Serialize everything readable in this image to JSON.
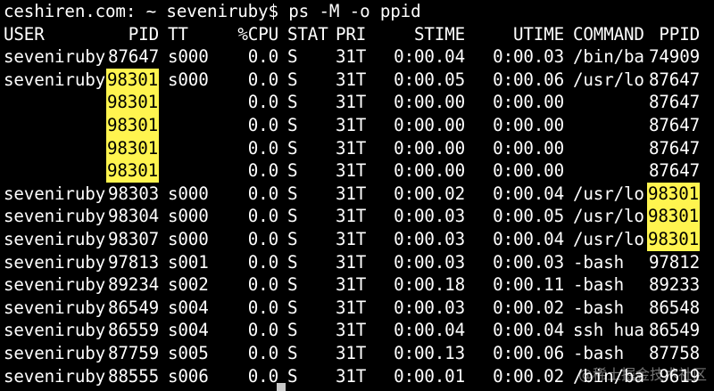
{
  "prompt": "ceshiren.com: ~ seveniruby$ ps -M -o ppid",
  "headers": [
    "USER",
    "PID",
    "TT",
    "%CPU",
    "STAT",
    "PRI",
    "STIME",
    "UTIME",
    "COMMAND",
    "PPID"
  ],
  "rows": [
    {
      "user": "seveniruby",
      "pid": "87647",
      "tt": "s000",
      "cpu": "0.0",
      "stat": "S",
      "pri": "31T",
      "stime": "0:00.04",
      "utime": "0:00.03",
      "command": "/bin/ba",
      "ppid": "74909",
      "pid_hl": false,
      "ppid_hl": false
    },
    {
      "user": "seveniruby",
      "pid": "98301",
      "tt": "s000",
      "cpu": "0.0",
      "stat": "S",
      "pri": "31T",
      "stime": "0:00.05",
      "utime": "0:00.06",
      "command": "/usr/lo",
      "ppid": "87647",
      "pid_hl": true,
      "ppid_hl": false
    },
    {
      "user": "",
      "pid": "98301",
      "tt": "",
      "cpu": "0.0",
      "stat": "S",
      "pri": "31T",
      "stime": "0:00.00",
      "utime": "0:00.00",
      "command": "",
      "ppid": "87647",
      "pid_hl": true,
      "ppid_hl": false
    },
    {
      "user": "",
      "pid": "98301",
      "tt": "",
      "cpu": "0.0",
      "stat": "S",
      "pri": "31T",
      "stime": "0:00.00",
      "utime": "0:00.00",
      "command": "",
      "ppid": "87647",
      "pid_hl": true,
      "ppid_hl": false
    },
    {
      "user": "",
      "pid": "98301",
      "tt": "",
      "cpu": "0.0",
      "stat": "S",
      "pri": "31T",
      "stime": "0:00.00",
      "utime": "0:00.00",
      "command": "",
      "ppid": "87647",
      "pid_hl": true,
      "ppid_hl": false
    },
    {
      "user": "",
      "pid": "98301",
      "tt": "",
      "cpu": "0.0",
      "stat": "S",
      "pri": "31T",
      "stime": "0:00.00",
      "utime": "0:00.00",
      "command": "",
      "ppid": "87647",
      "pid_hl": true,
      "ppid_hl": false
    },
    {
      "user": "seveniruby",
      "pid": "98303",
      "tt": "s000",
      "cpu": "0.0",
      "stat": "S",
      "pri": "31T",
      "stime": "0:00.02",
      "utime": "0:00.04",
      "command": "/usr/lo",
      "ppid": "98301",
      "pid_hl": false,
      "ppid_hl": true
    },
    {
      "user": "seveniruby",
      "pid": "98304",
      "tt": "s000",
      "cpu": "0.0",
      "stat": "S",
      "pri": "31T",
      "stime": "0:00.03",
      "utime": "0:00.05",
      "command": "/usr/lo",
      "ppid": "98301",
      "pid_hl": false,
      "ppid_hl": true
    },
    {
      "user": "seveniruby",
      "pid": "98307",
      "tt": "s000",
      "cpu": "0.0",
      "stat": "S",
      "pri": "31T",
      "stime": "0:00.03",
      "utime": "0:00.04",
      "command": "/usr/lo",
      "ppid": "98301",
      "pid_hl": false,
      "ppid_hl": true
    },
    {
      "user": "seveniruby",
      "pid": "97813",
      "tt": "s001",
      "cpu": "0.0",
      "stat": "S",
      "pri": "31T",
      "stime": "0:00.03",
      "utime": "0:00.03",
      "command": "-bash",
      "ppid": "97812",
      "pid_hl": false,
      "ppid_hl": false
    },
    {
      "user": "seveniruby",
      "pid": "89234",
      "tt": "s002",
      "cpu": "0.0",
      "stat": "S",
      "pri": "31T",
      "stime": "0:00.18",
      "utime": "0:00.11",
      "command": "-bash",
      "ppid": "89233",
      "pid_hl": false,
      "ppid_hl": false
    },
    {
      "user": "seveniruby",
      "pid": "86549",
      "tt": "s004",
      "cpu": "0.0",
      "stat": "S",
      "pri": "31T",
      "stime": "0:00.03",
      "utime": "0:00.02",
      "command": "-bash",
      "ppid": "86548",
      "pid_hl": false,
      "ppid_hl": false
    },
    {
      "user": "seveniruby",
      "pid": "86559",
      "tt": "s004",
      "cpu": "0.0",
      "stat": "S",
      "pri": "31T",
      "stime": "0:00.04",
      "utime": "0:00.04",
      "command": "ssh hua",
      "ppid": "86549",
      "pid_hl": false,
      "ppid_hl": false
    },
    {
      "user": "seveniruby",
      "pid": "87759",
      "tt": "s005",
      "cpu": "0.0",
      "stat": "S",
      "pri": "31T",
      "stime": "0:00.13",
      "utime": "0:00.06",
      "command": "-bash",
      "ppid": "87758",
      "pid_hl": false,
      "ppid_hl": false
    },
    {
      "user": "seveniruby",
      "pid": "88555",
      "tt": "s006",
      "cpu": "0.0",
      "stat": "S",
      "pri": "31T",
      "stime": "0:00.01",
      "utime": "0:00.02",
      "command": "/bin/ba",
      "ppid": "9619",
      "pid_hl": false,
      "ppid_hl": false
    }
  ],
  "watermark": "@稀土掘金技术社区",
  "colors": {
    "background": "#000000",
    "text": "#ffffff",
    "highlight": "#fff44f",
    "highlight_text": "#000000"
  }
}
